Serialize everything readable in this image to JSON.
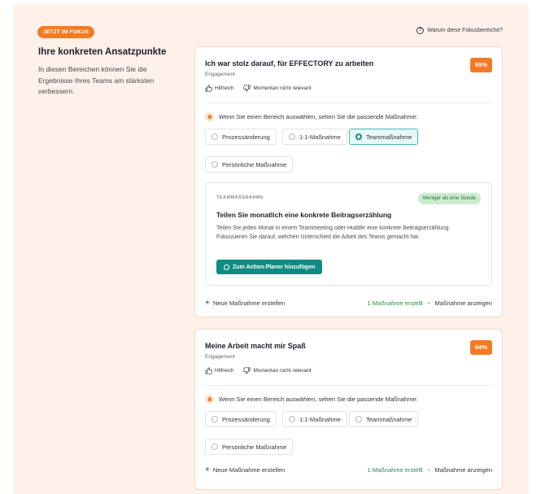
{
  "header": {
    "badge": "JETZT IM FOKUS",
    "why_link": "Warum diese Fokusbereiche?"
  },
  "intro": {
    "title": "Ihre konkreten Ansatzpunkte",
    "description": "In diesen Bereichen können Sie die Ergebnisse Ihres Teams am stärksten verbessern."
  },
  "feedback": {
    "helpful": "Hilfreich",
    "not_relevant": "Momentan nicht relevant"
  },
  "hint": "Wenn Sie einen Bereich auswählen, sehen Sie die passende Maßnahme:",
  "options": [
    "Prozessänderung",
    "1:1-Maßnahme",
    "Teammaßnahme",
    "Persönliche Maßnahme"
  ],
  "cards": [
    {
      "title": "Ich war stolz darauf, für EFFECTORY zu arbeiten",
      "category": "Engagement",
      "score": "69%",
      "selected_option": "Teammaßnahme",
      "action": {
        "category": "TEAMMASSNAHME",
        "duration": "Weniger als eine Stunde",
        "title": "Teilen Sie monatlich eine konkrete Beitragserzählung",
        "description": "Teilen Sie jeden Monat in einem Teammeeting oder Huddle eine konkrete Beitragserzählung. Fokussieren Sie darauf, welchen Unterschied die Arbeit des Teams gemacht hat.",
        "button": "Zum Action-Planer hinzufügen"
      }
    },
    {
      "title": "Meine Arbeit macht mir Spaß",
      "category": "Engagement",
      "score": "64%",
      "selected_option": ""
    }
  ],
  "footer": {
    "new_action": "Neue Maßnahme erstellen",
    "created": "1 Maßnahme erstellt",
    "separator": "•",
    "show_actions": "Maßnahme anzeigen"
  },
  "colors": {
    "accent_orange": "#f47b25",
    "teal": "#0f8c82",
    "background": "#fdf1e9"
  }
}
